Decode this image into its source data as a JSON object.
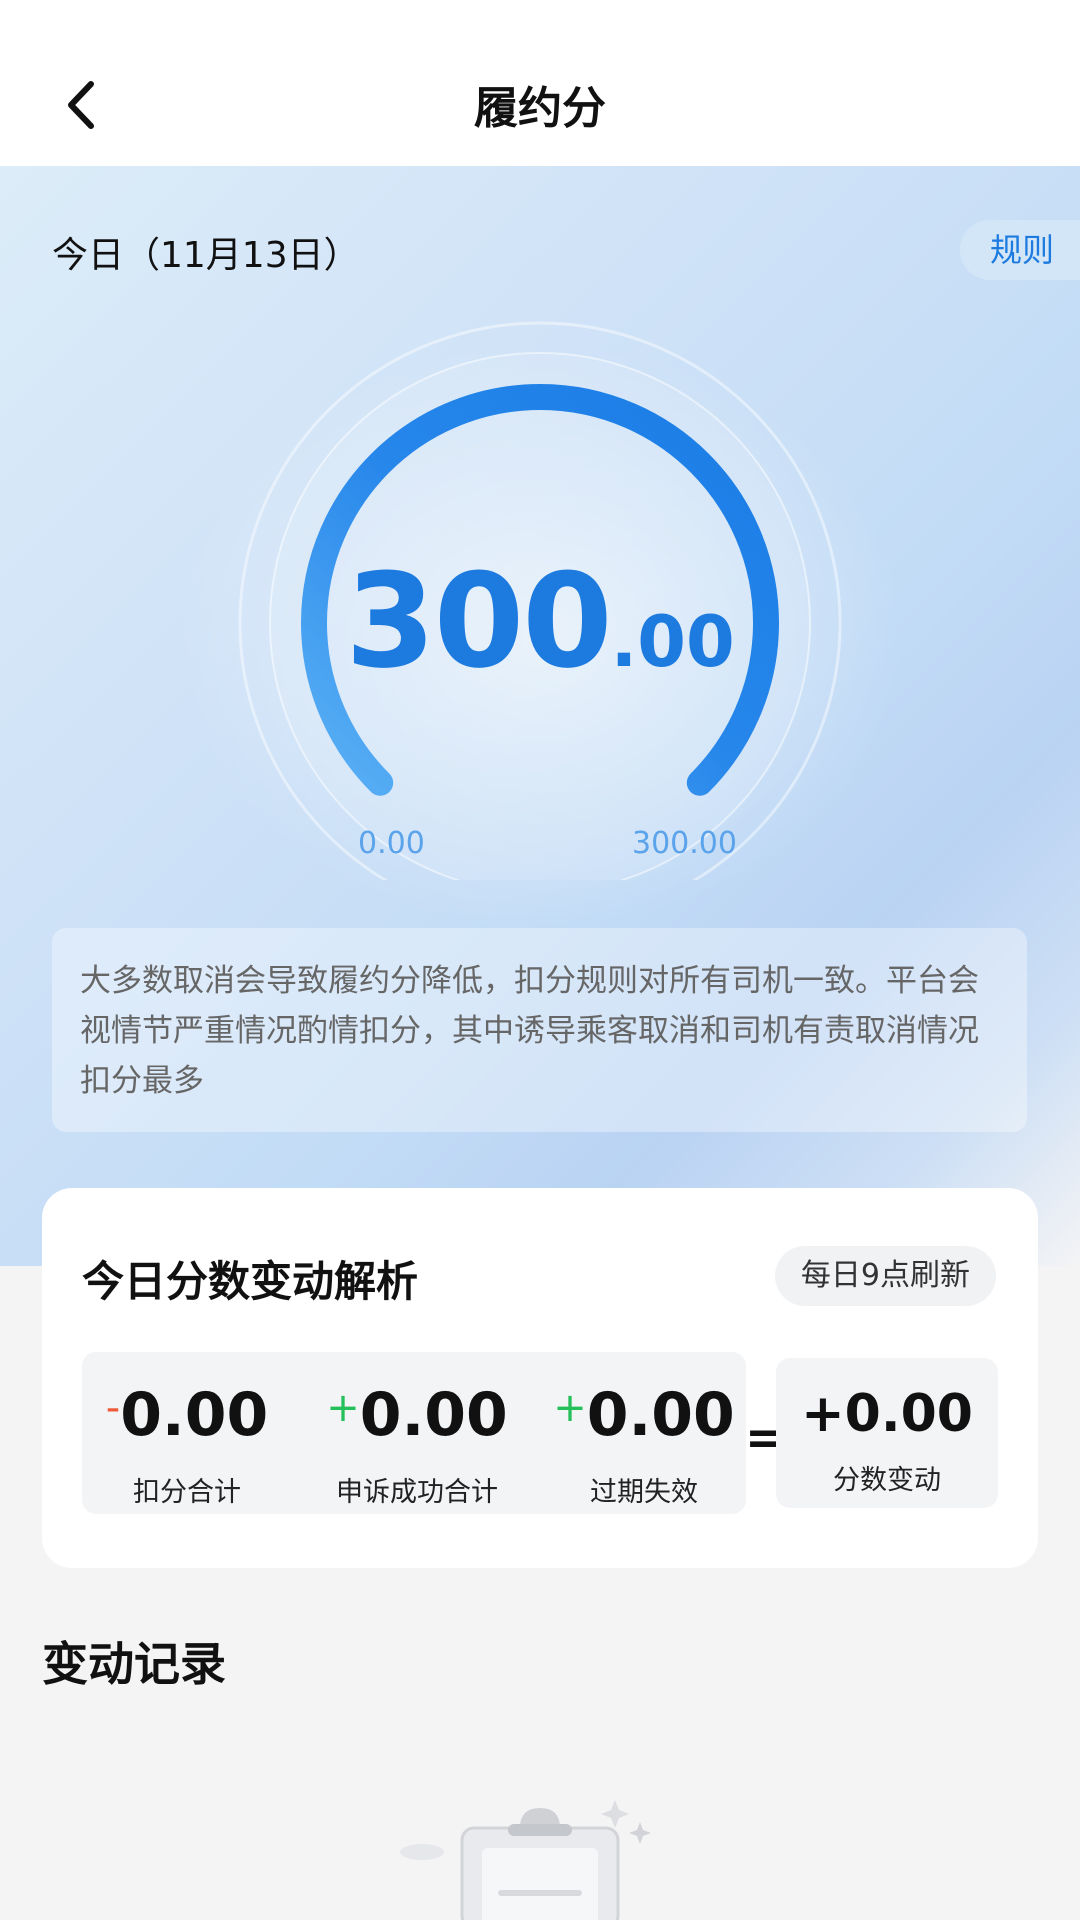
{
  "header": {
    "title": "履约分"
  },
  "today": {
    "date_label": "今日（11月13日）",
    "rules_label": "规则"
  },
  "gauge": {
    "value_int": "300",
    "value_dec": ".00",
    "min_label": "0.00",
    "max_label": "300.00",
    "progress": 1.0
  },
  "notice": {
    "text": "大多数取消会导致履约分降低，扣分规则对所有司机一致。平台会视情节严重情况酌情扣分，其中诱导乘客取消和司机有责取消情况扣分最多"
  },
  "analysis": {
    "title": "今日分数变动解析",
    "refresh_label": "每日9点刷新",
    "stats": [
      {
        "sign": "-",
        "value": "0.00",
        "label": "扣分合计"
      },
      {
        "sign": "+",
        "value": "0.00",
        "label": "申诉成功合计"
      },
      {
        "sign": "+",
        "value": "0.00",
        "label": "过期失效"
      }
    ],
    "equals": "=",
    "result": {
      "value": "+0.00",
      "label": "分数变动"
    }
  },
  "records": {
    "title": "变动记录"
  },
  "colors": {
    "accent": "#1d7be0",
    "negative": "#f05a3a",
    "positive": "#25c05a"
  }
}
